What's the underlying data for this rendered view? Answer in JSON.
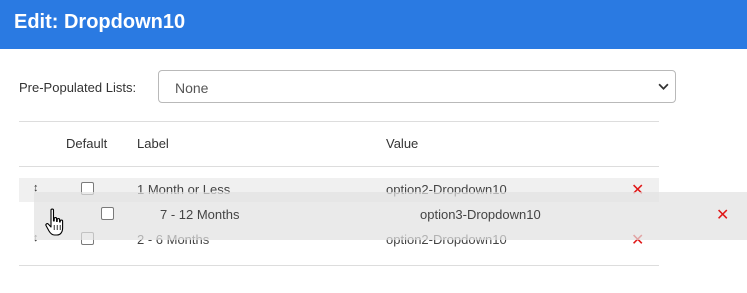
{
  "header": {
    "title": "Edit: Dropdown10",
    "bg_color": "#2a7ae2"
  },
  "prepopulated": {
    "label": "Pre-Populated Lists:",
    "selected": "None"
  },
  "table": {
    "columns": {
      "default": "Default",
      "label": "Label",
      "value": "Value"
    },
    "rows": [
      {
        "label": "1 Month or Less",
        "value": "option2-Dropdown10",
        "default": false
      },
      {
        "label": "2 - 6 Months",
        "value": "option2-Dropdown10",
        "default": false
      }
    ],
    "dragging_row": {
      "label": "7 - 12 Months",
      "value": "option3-Dropdown10",
      "default": false
    }
  },
  "icons": {
    "drag_handle": "↕",
    "delete": "✕"
  },
  "colors": {
    "delete": "#e01818",
    "row_highlight": "#f0f0f0"
  }
}
